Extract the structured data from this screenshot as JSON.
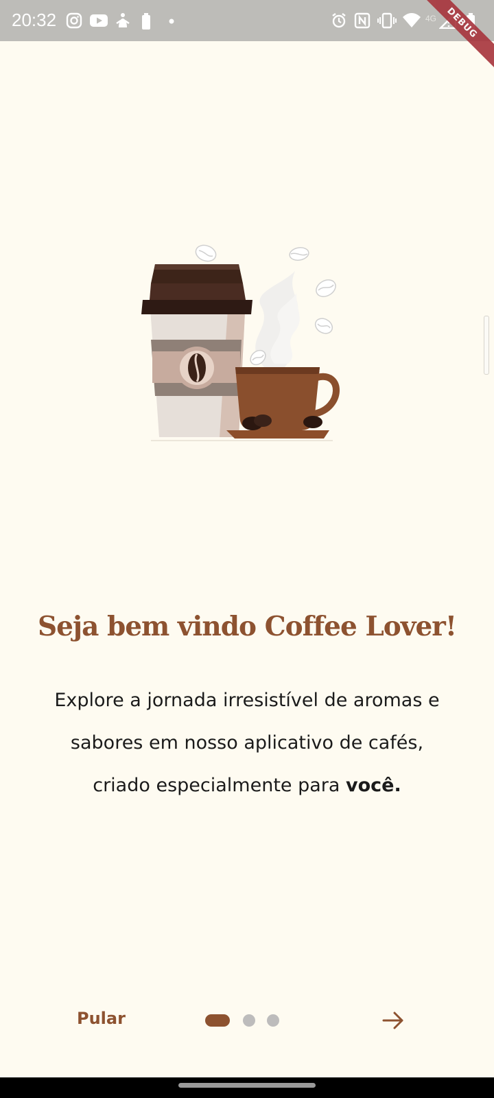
{
  "status_bar": {
    "time": "20:32",
    "network": "4G",
    "icons": [
      "instagram-icon",
      "youtube-icon",
      "app-icon",
      "battery-saver-icon",
      "dot-icon",
      "alarm-icon",
      "nfc-icon",
      "vibrate-icon",
      "wifi-icon",
      "signal-icon",
      "battery-icon"
    ]
  },
  "debug_banner": "DEBUG",
  "onboarding": {
    "title": "Seja bem vindo Coffee Lover!",
    "description": "Explore a jornada irresistível de aromas e sabores em nosso aplicativo de cafés, criado especialmente para",
    "description_emphasis": "você.",
    "skip_label": "Pular",
    "page_current": 1,
    "page_total": 3
  },
  "colors": {
    "background": "#fefbf1",
    "accent": "#8d5230",
    "dot_inactive": "#bdbcbc",
    "status_bar": "#bdbcb8"
  }
}
